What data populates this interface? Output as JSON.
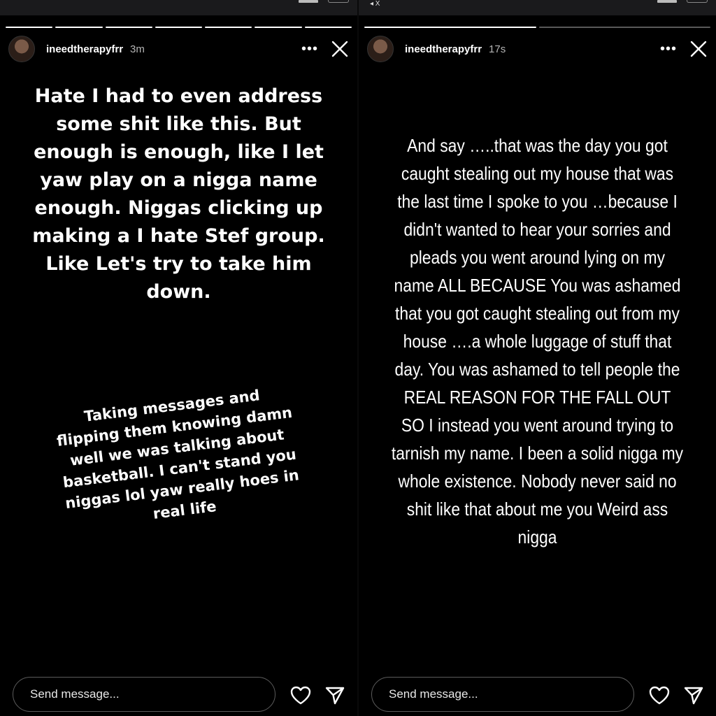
{
  "left_story": {
    "username": "ineedtherapyfrr",
    "time": "3m",
    "more_label": "•••",
    "progress_segments": 7,
    "progress_filled": 7,
    "main_text": "Hate I had to even address some shit like this. But enough is enough, like I let yaw play on a nigga name enough. Niggas clicking up making a I hate Stef group. Like Let's try to take him down.",
    "secondary_text": "Taking messages and flipping them knowing damn well we was talking about basketball. I can't stand you niggas lol yaw really hoes in real life",
    "message_placeholder": "Send message..."
  },
  "right_story": {
    "back_label": "◂ X",
    "username": "ineedtherapyfrr",
    "time": "17s",
    "more_label": "•••",
    "progress_segments": 2,
    "progress_filled": 1,
    "main_text": "And say …..that was the day you got caught stealing out my house that was the last time I spoke to you …because I didn't wanted to hear your sorries and pleads you went around lying on my name ALL BECAUSE You was ashamed that you got caught stealing out from my house ….a whole luggage of stuff that day. You was ashamed to tell people the REAL REASON FOR THE FALL OUT SO I instead you went around trying to tarnish my name. I been a solid nigga my whole existence. Nobody never said no shit like that about me you Weird ass nigga",
    "message_placeholder": "Send message..."
  },
  "icons": {
    "more": "more-options-icon",
    "close": "close-icon",
    "like": "heart-icon",
    "send": "send-icon"
  },
  "colors": {
    "background": "#000000",
    "text": "#ffffff",
    "secondary_text": "#b5b5b5",
    "input_border": "#5b5b5b"
  }
}
